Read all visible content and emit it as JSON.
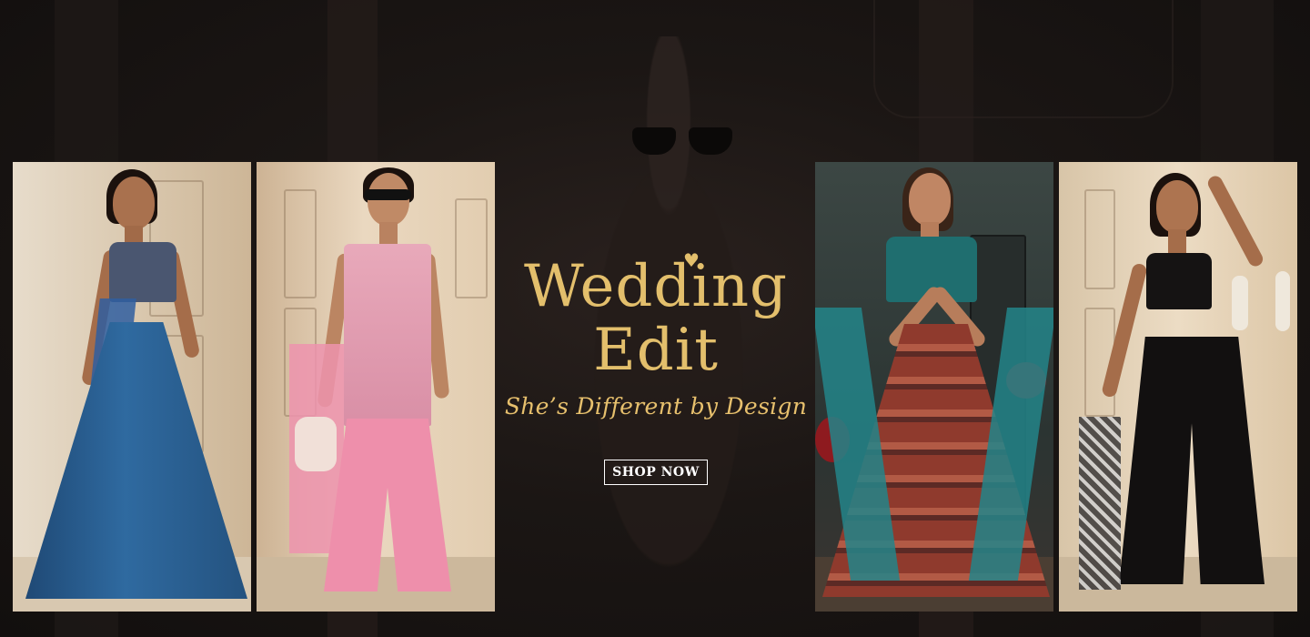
{
  "banner": {
    "title_line1": "Wedding",
    "title_line2": "Edit",
    "heart_icon": "♥",
    "tagline": "She’s Different by Design",
    "cta_label": "SHOP NOW"
  },
  "colors": {
    "gold": "#e3bf6c",
    "background": "#171312",
    "button_border": "#ffffff"
  },
  "photos": [
    {
      "name": "blue-lehenga-look",
      "outfit_color": "#2c5f8f"
    },
    {
      "name": "pink-sharara-look",
      "outfit_color": "#e79ab0"
    },
    {
      "name": "teal-printed-lehenga-look",
      "outfit_color": "#1f7a78"
    },
    {
      "name": "black-palazzo-look",
      "outfit_color": "#141212"
    }
  ]
}
